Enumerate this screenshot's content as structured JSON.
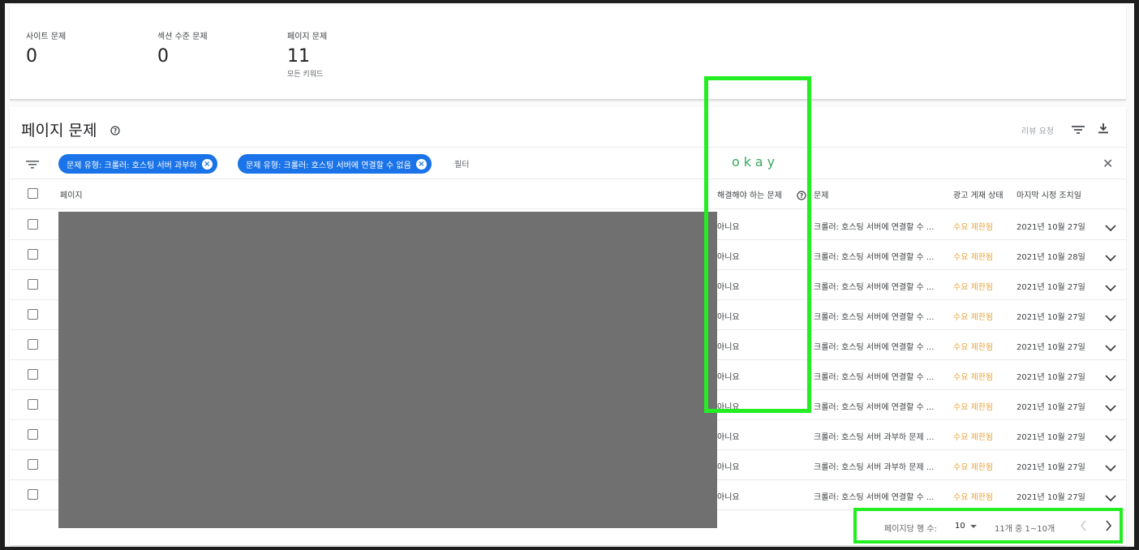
{
  "summary": {
    "site_issues_label": "사이트 문제",
    "site_issues_value": "0",
    "section_issues_label": "섹션 수준 문제",
    "section_issues_value": "0",
    "page_issues_label": "페이지 문제",
    "page_issues_value": "11",
    "page_issues_sub": "모든 키워드"
  },
  "card": {
    "title": "페이지 문제",
    "review_request": "리뷰 요청"
  },
  "filters": {
    "chips": [
      "문제 유형: 크롤러: 호스팅 서버 과부하",
      "문제 유형: 크롤러: 호스팅 서버에 연결할 수 없음"
    ],
    "filter_word": "필터",
    "overlay_text": "okay"
  },
  "table": {
    "headers": {
      "page": "페이지",
      "must_resolve": "해결해야 하는 문제",
      "issue": "문제",
      "ad_status": "광고 게재 상태",
      "last_action": "마지막 시정 조치일"
    },
    "rows": [
      {
        "resolve": "아니요",
        "issue": "크롤러: 호스팅 서버에 연결할 수 ...",
        "status": "수요 제한됨",
        "date": "2021년 10월 27일"
      },
      {
        "resolve": "아니요",
        "issue": "크롤러: 호스팅 서버에 연결할 수 ...",
        "status": "수요 제한됨",
        "date": "2021년 10월 28일"
      },
      {
        "resolve": "아니요",
        "issue": "크롤러: 호스팅 서버에 연결할 수 ...",
        "status": "수요 제한됨",
        "date": "2021년 10월 27일"
      },
      {
        "resolve": "아니요",
        "issue": "크롤러: 호스팅 서버에 연결할 수 ...",
        "status": "수요 제한됨",
        "date": "2021년 10월 27일"
      },
      {
        "resolve": "아니요",
        "issue": "크롤러: 호스팅 서버에 연결할 수 ...",
        "status": "수요 제한됨",
        "date": "2021년 10월 27일"
      },
      {
        "resolve": "아니요",
        "issue": "크롤러: 호스팅 서버에 연결할 수 ...",
        "status": "수요 제한됨",
        "date": "2021년 10월 27일"
      },
      {
        "resolve": "아니요",
        "issue": "크롤러: 호스팅 서버에 연결할 수 ...",
        "status": "수요 제한됨",
        "date": "2021년 10월 27일"
      },
      {
        "resolve": "아니요",
        "issue": "크롤러: 호스팅 서버 과부하 문제 ...",
        "status": "수요 제한됨",
        "date": "2021년 10월 27일"
      },
      {
        "resolve": "아니요",
        "issue": "크롤러: 호스팅 서버 과부하 문제 ...",
        "status": "수요 제한됨",
        "date": "2021년 10월 27일"
      },
      {
        "resolve": "아니요",
        "issue": "크롤러: 호스팅 서버에 연결할 수 ...",
        "status": "수요 제한됨",
        "date": "2021년 10월 27일"
      }
    ]
  },
  "pager": {
    "rows_per_page_label": "페이지당 행 수:",
    "rows_per_page_value": "10",
    "range": "11개 중 1~10개"
  },
  "colors": {
    "chip": "#1a73e8",
    "status": "#e8a33b",
    "highlight": "#22ee22"
  }
}
